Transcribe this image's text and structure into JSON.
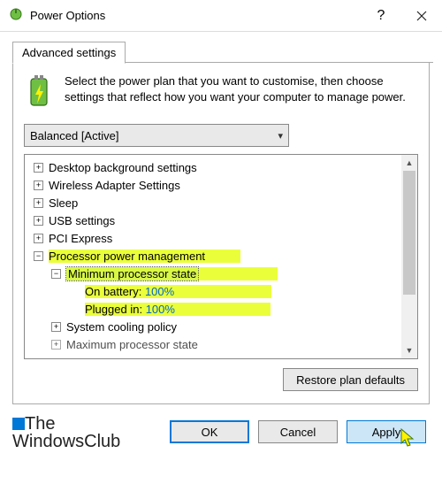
{
  "window": {
    "title": "Power Options"
  },
  "tab": {
    "label": "Advanced settings"
  },
  "info": {
    "text": "Select the power plan that you want to customise, then choose settings that reflect how you want your computer to manage power."
  },
  "plan": {
    "selected": "Balanced [Active]"
  },
  "tree": {
    "items": [
      {
        "label": "Desktop background settings"
      },
      {
        "label": "Wireless Adapter Settings"
      },
      {
        "label": "Sleep"
      },
      {
        "label": "USB settings"
      },
      {
        "label": "PCI Express"
      }
    ],
    "processor": {
      "label": "Processor power management",
      "min_state": {
        "label": "Minimum processor state",
        "on_battery_label": "On battery:",
        "on_battery_value": "100%",
        "plugged_in_label": "Plugged in:",
        "plugged_in_value": "100%"
      },
      "cooling": {
        "label": "System cooling policy"
      },
      "max_state": {
        "label": "Maximum processor state"
      }
    }
  },
  "buttons": {
    "restore": "Restore plan defaults",
    "ok": "OK",
    "cancel": "Cancel",
    "apply": "Apply"
  },
  "watermark": {
    "line1": "The",
    "line2": "WindowsClub"
  }
}
